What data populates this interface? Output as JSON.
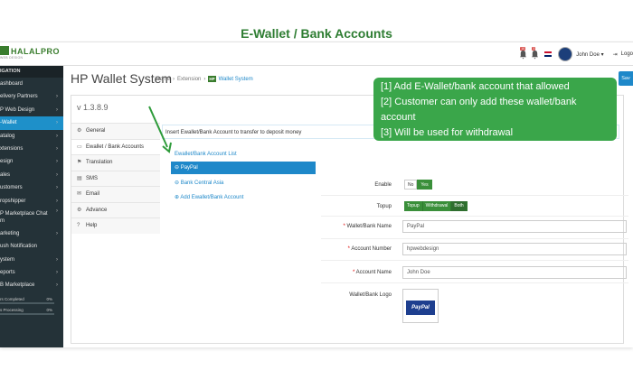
{
  "banner": {
    "title": "E-Wallet / Bank Accounts"
  },
  "topbar": {
    "logo_text": "HALALPRO",
    "logo_sub": "WEB DESIGN",
    "bell1_count": "10",
    "bell2_count": "3",
    "user_name": "John Doe ▾",
    "logout": "Logo"
  },
  "sidebar": {
    "heading": "IGATION",
    "items": [
      {
        "label": "ashboard",
        "chev": ""
      },
      {
        "label": "elivery Partners",
        "chev": "›"
      },
      {
        "label": "P Web Design",
        "chev": "›"
      },
      {
        "label": "-Wallet",
        "chev": "›"
      },
      {
        "label": "atalog",
        "chev": "›"
      },
      {
        "label": "xtensions",
        "chev": "›"
      },
      {
        "label": "esign",
        "chev": "›"
      },
      {
        "label": "ales",
        "chev": "›"
      },
      {
        "label": "ustomers",
        "chev": "›"
      },
      {
        "label": "ropshipper",
        "chev": "›"
      },
      {
        "label": "P Marketplace Chat\nm",
        "chev": "›"
      },
      {
        "label": "arketing",
        "chev": "›"
      },
      {
        "label": "ush Notification",
        "chev": ""
      },
      {
        "label": "ystem",
        "chev": "›"
      },
      {
        "label": "eports",
        "chev": "›"
      },
      {
        "label": "B Marketplace",
        "chev": "›"
      }
    ],
    "progress": [
      {
        "label": "rs Completed",
        "pct": "0%",
        "value": 0
      },
      {
        "label": "s Processing",
        "pct": "0%",
        "value": 0
      }
    ]
  },
  "header": {
    "title": "HP Wallet System",
    "crumb_home": "Home",
    "crumb_ext": "Extension",
    "crumb_hp": "HP",
    "crumb_current": "Wallet System",
    "save": "Sav"
  },
  "version": "v 1.3.8.9",
  "menu": [
    {
      "icon": "⚙",
      "label": "General"
    },
    {
      "icon": "▭",
      "label": "Ewallet / Bank Accounts"
    },
    {
      "icon": "⚑",
      "label": "Translation"
    },
    {
      "icon": "▤",
      "label": "SMS"
    },
    {
      "icon": "✉",
      "label": "Email"
    },
    {
      "icon": "⚙",
      "label": "Advance"
    },
    {
      "icon": "?",
      "label": "Help"
    }
  ],
  "desc": "Insert Ewallet/Bank Account to transfer to deposit money",
  "list": {
    "title": "Ewallet/Bank Account List",
    "items": [
      "⊖ PayPal",
      "⊖ Bank Central Asia",
      "⊕ Add Ewallet/Bank Account"
    ]
  },
  "form": {
    "enable_label": "Enable",
    "enable_no": "No",
    "enable_yes": "Yes",
    "topup_label": "Topup",
    "topup_opts": [
      "Topup",
      "Withdrawal",
      "Both"
    ],
    "name_label": "Wallet/Bank Name",
    "name_value": "PayPal",
    "num_label": "Account Number",
    "num_value": "hpwebdesign",
    "acc_label": "Account Name",
    "acc_value": "John Doe",
    "logo_label": "Wallet/Bank Logo",
    "logo_text": "PayPal"
  },
  "callout": {
    "lines": [
      "[1] Add E-Wallet/bank account that allowed",
      "[2] Customer can only add these wallet/bank account",
      "[3] Will be used for withdrawal"
    ]
  },
  "colors": {
    "brand_green": "#3a7d2e",
    "accent_blue": "#1e88c9",
    "sidebar_bg": "#243238",
    "callout_green": "#3aa64a"
  }
}
